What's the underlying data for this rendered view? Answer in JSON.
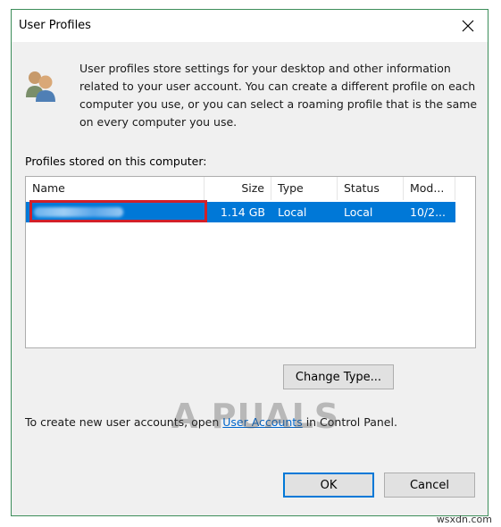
{
  "window": {
    "title": "User Profiles"
  },
  "description": "User profiles store settings for your desktop and other information related to your user account. You can create a different profile on each computer you use, or you can select a roaming profile that is the same on every computer you use.",
  "profiles_label": "Profiles stored on this computer:",
  "table": {
    "columns": [
      "Name",
      "Size",
      "Type",
      "Status",
      "Mod..."
    ],
    "rows": [
      {
        "name": "",
        "size": "1.14 GB",
        "type": "Local",
        "status": "Local",
        "modified": "10/2...",
        "selected": true
      }
    ]
  },
  "buttons": {
    "change_type": "Change Type...",
    "ok": "OK",
    "cancel": "Cancel"
  },
  "footer": {
    "prefix": "To create new user accounts, open ",
    "link": "User Accounts",
    "suffix": " in Control Panel."
  },
  "watermark": "A PUALS",
  "site_mark": "wsxdn.com",
  "colors": {
    "selection": "#0078d7",
    "highlight_box": "#d1202a",
    "link": "#0066cc",
    "window_border": "#3c8d5a"
  }
}
